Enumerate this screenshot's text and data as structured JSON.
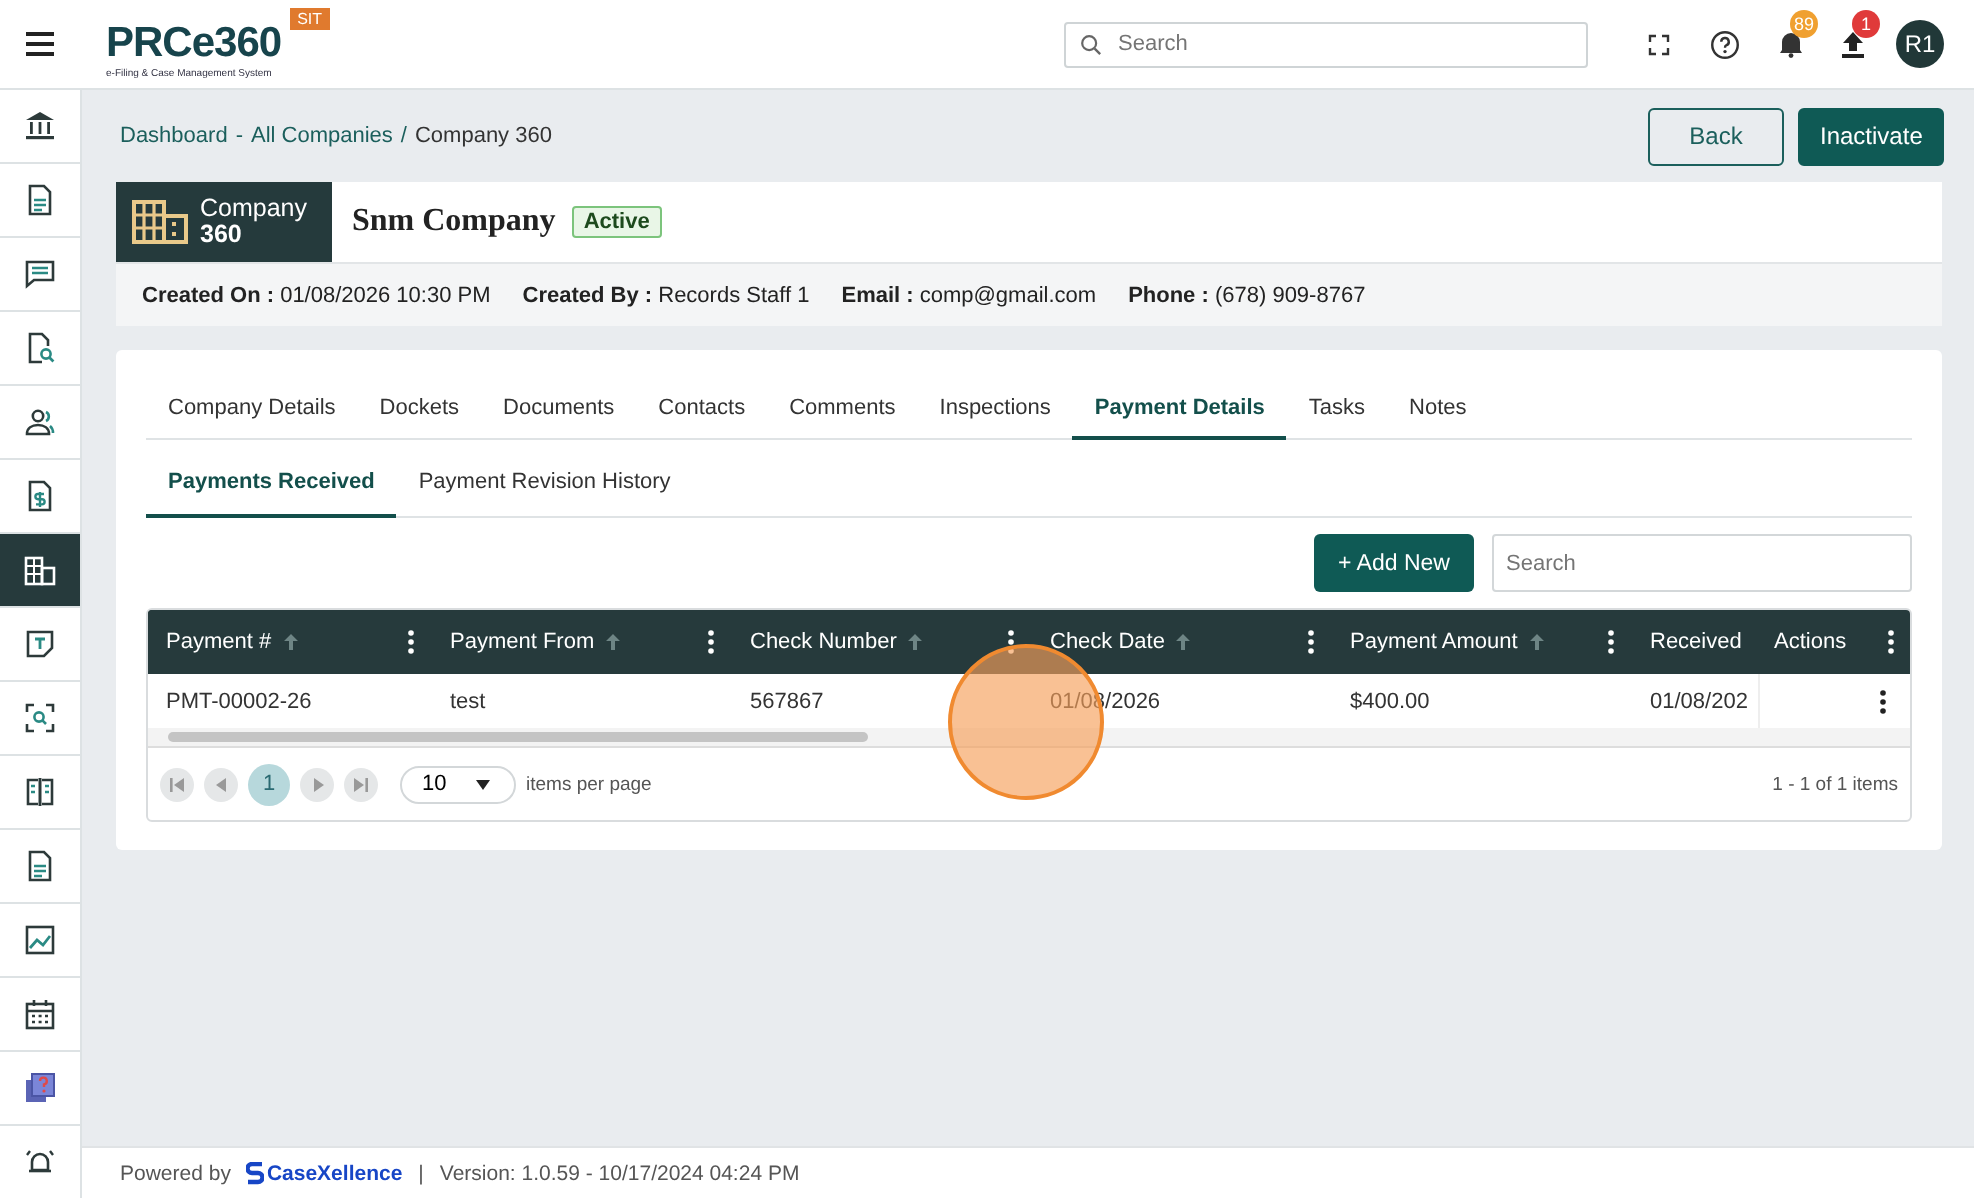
{
  "header": {
    "logo": "PRCe360",
    "logo_tagline": "e-Filing & Case Management System",
    "env_badge": "SIT",
    "search": {
      "placeholder": "Search"
    },
    "notifications": "89",
    "uploads": "1",
    "avatar": "R1"
  },
  "sidebar": {
    "items": [
      {
        "selected": false
      },
      {
        "selected": false
      },
      {
        "selected": false
      },
      {
        "selected": false
      },
      {
        "selected": false
      },
      {
        "selected": false
      },
      {
        "selected": true
      },
      {
        "selected": false
      },
      {
        "selected": false
      },
      {
        "selected": false
      },
      {
        "selected": false
      },
      {
        "selected": false
      },
      {
        "selected": false
      },
      {
        "selected": false
      },
      {
        "selected": false
      }
    ]
  },
  "breadcrumb": {
    "links": [
      "Dashboard",
      "All Companies"
    ],
    "separator": "-",
    "current_separator": "/",
    "current": "Company 360"
  },
  "actions": [
    "Back",
    "Inactivate"
  ],
  "company": {
    "badge_title": "Company",
    "badge_number": "360",
    "name": "Snm Company",
    "status": "Active"
  },
  "info": [
    {
      "label": "Created On :",
      "value": "01/08/2026 10:30 PM"
    },
    {
      "label": "Created By :",
      "value": "Records Staff 1"
    },
    {
      "label": "Email :",
      "value": "comp@gmail.com"
    },
    {
      "label": "Phone :",
      "value": "(678) 909-8767"
    }
  ],
  "tabs": [
    {
      "label": "Company Details",
      "selected": false
    },
    {
      "label": "Dockets",
      "selected": false
    },
    {
      "label": "Documents",
      "selected": false
    },
    {
      "label": "Contacts",
      "selected": false
    },
    {
      "label": "Comments",
      "selected": false
    },
    {
      "label": "Inspections",
      "selected": false
    },
    {
      "label": "Payment Details",
      "selected": true
    },
    {
      "label": "Tasks",
      "selected": false
    },
    {
      "label": "Notes",
      "selected": false
    }
  ],
  "subtabs": [
    {
      "label": "Payments Received",
      "selected": true
    },
    {
      "label": "Payment Revision History",
      "selected": false
    }
  ],
  "add_button": "+ Add New",
  "table_search": {
    "placeholder": "Search"
  },
  "table": {
    "columns": [
      {
        "label": "Payment #",
        "sortable": true,
        "menu": true
      },
      {
        "label": "Payment From",
        "sortable": true,
        "menu": true
      },
      {
        "label": "Check Number",
        "sortable": true,
        "menu": true
      },
      {
        "label": "Check Date",
        "sortable": true,
        "menu": true
      },
      {
        "label": "Payment Amount",
        "sortable": true,
        "menu": true
      },
      {
        "label": "Received",
        "sortable": false,
        "menu": false
      }
    ],
    "actions_column": "Actions",
    "rows": [
      {
        "cells": [
          "PMT-00002-26",
          "test",
          "567867",
          "01/08/2026",
          "$400.00",
          "01/08/202"
        ]
      }
    ]
  },
  "pager": {
    "pages": [
      {
        "label": "1",
        "selected": true
      }
    ],
    "page_size": "10",
    "page_size_label": "items per page",
    "summary": "1 - 1 of 1 items"
  },
  "footer": {
    "powered_by": "Powered by",
    "brand": "CaseXellence",
    "separator": "|",
    "version": "Version: 1.0.59 - 10/17/2024 04:24 PM"
  }
}
